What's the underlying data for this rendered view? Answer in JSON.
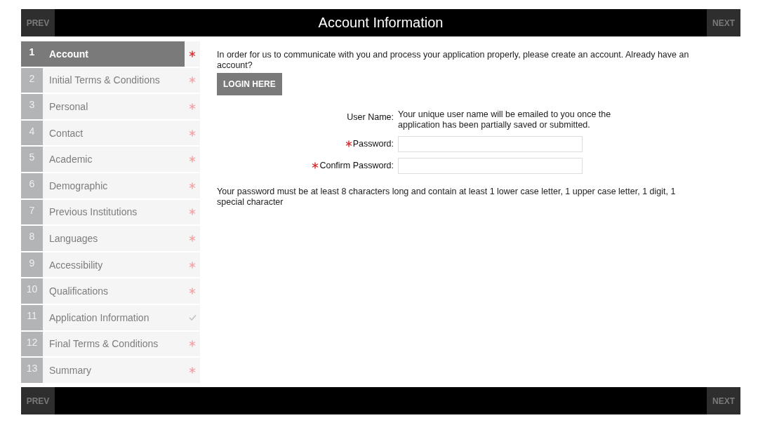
{
  "header": {
    "title": "Account Information",
    "prev": "PREV",
    "next": "NEXT"
  },
  "steps": [
    {
      "number": "1",
      "label": "Account",
      "kind": "required",
      "selected": true
    },
    {
      "number": "2",
      "label": "Initial Terms & Conditions",
      "kind": "required",
      "selected": false
    },
    {
      "number": "3",
      "label": "Personal",
      "kind": "required",
      "selected": false
    },
    {
      "number": "4",
      "label": "Contact",
      "kind": "required",
      "selected": false
    },
    {
      "number": "5",
      "label": "Academic",
      "kind": "required",
      "selected": false
    },
    {
      "number": "6",
      "label": "Demographic",
      "kind": "required",
      "selected": false
    },
    {
      "number": "7",
      "label": "Previous Institutions",
      "kind": "required",
      "selected": false
    },
    {
      "number": "8",
      "label": "Languages",
      "kind": "required",
      "selected": false
    },
    {
      "number": "9",
      "label": "Accessibility",
      "kind": "required",
      "selected": false
    },
    {
      "number": "10",
      "label": "Qualifications",
      "kind": "required",
      "selected": false
    },
    {
      "number": "11",
      "label": "Application Information",
      "kind": "complete",
      "selected": false
    },
    {
      "number": "12",
      "label": "Final Terms & Conditions",
      "kind": "required",
      "selected": false
    },
    {
      "number": "13",
      "label": "Summary",
      "kind": "required",
      "selected": false
    }
  ],
  "intro": "In order for us to communicate with you and process your application properly, please create an account. Already have an account?",
  "login_button": "LOGIN HERE",
  "fields": [
    {
      "kind": "note",
      "label": "User Name:",
      "required": false,
      "text": "Your unique user name will be emailed to you once the application has been partially saved or submitted."
    },
    {
      "kind": "input",
      "label": "Password:",
      "required": true
    },
    {
      "kind": "input",
      "label": "Confirm Password:",
      "required": true
    }
  ],
  "password_rules": "Your password must be at least 8 characters long and contain at least 1 lower case letter, 1 upper case letter, 1 digit, 1 special character",
  "footer": {
    "prev": "PREV",
    "next": "NEXT"
  }
}
